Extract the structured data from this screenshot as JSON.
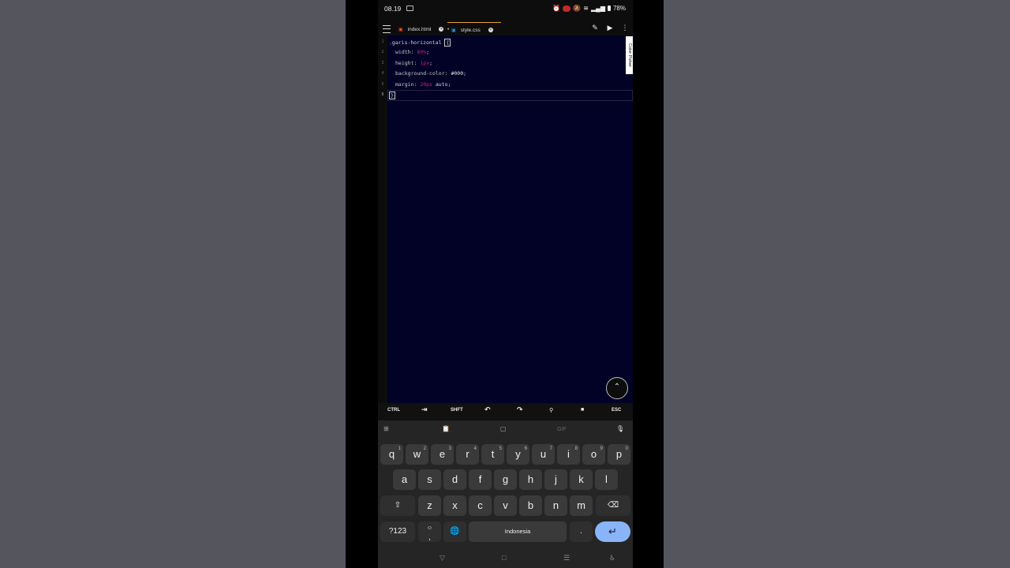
{
  "status": {
    "time": "08.19",
    "battery": "78%"
  },
  "tabs": [
    {
      "label": "index.html",
      "icon": "html-file-icon"
    },
    {
      "label": "style.css",
      "icon": "css-file-icon"
    }
  ],
  "editor": {
    "line_numbers": [
      "1",
      "2",
      "3",
      "4",
      "5",
      "6"
    ],
    "lines": [
      {
        "sel": ".garis-horizontal",
        "brace": "{"
      },
      {
        "prop": "width",
        "num": "80%",
        "rest": ";"
      },
      {
        "prop": "height",
        "num": "1px",
        "rest": ";"
      },
      {
        "prop": "background-color",
        "num": "",
        "rest": "#000;"
      },
      {
        "prop": "margin",
        "num": "20px",
        "rest": " auto;"
      },
      {
        "close": "}"
      }
    ],
    "color_picker_label": "Color Picker"
  },
  "extra_keys": [
    "CTRL",
    "SHFT",
    "ESC"
  ],
  "keyboard": {
    "row1": [
      [
        "q",
        "1"
      ],
      [
        "w",
        "2"
      ],
      [
        "e",
        "3"
      ],
      [
        "r",
        "4"
      ],
      [
        "t",
        "5"
      ],
      [
        "y",
        "6"
      ],
      [
        "u",
        "7"
      ],
      [
        "i",
        "8"
      ],
      [
        "o",
        "9"
      ],
      [
        "p",
        "0"
      ]
    ],
    "row2": [
      "a",
      "s",
      "d",
      "f",
      "g",
      "h",
      "j",
      "k",
      "l"
    ],
    "row3": [
      "z",
      "x",
      "c",
      "v",
      "b",
      "n",
      "m"
    ],
    "symbols_label": "?123",
    "comma": ",",
    "space_label": "Indonesia",
    "period": ".",
    "gif_label": "GIF"
  }
}
